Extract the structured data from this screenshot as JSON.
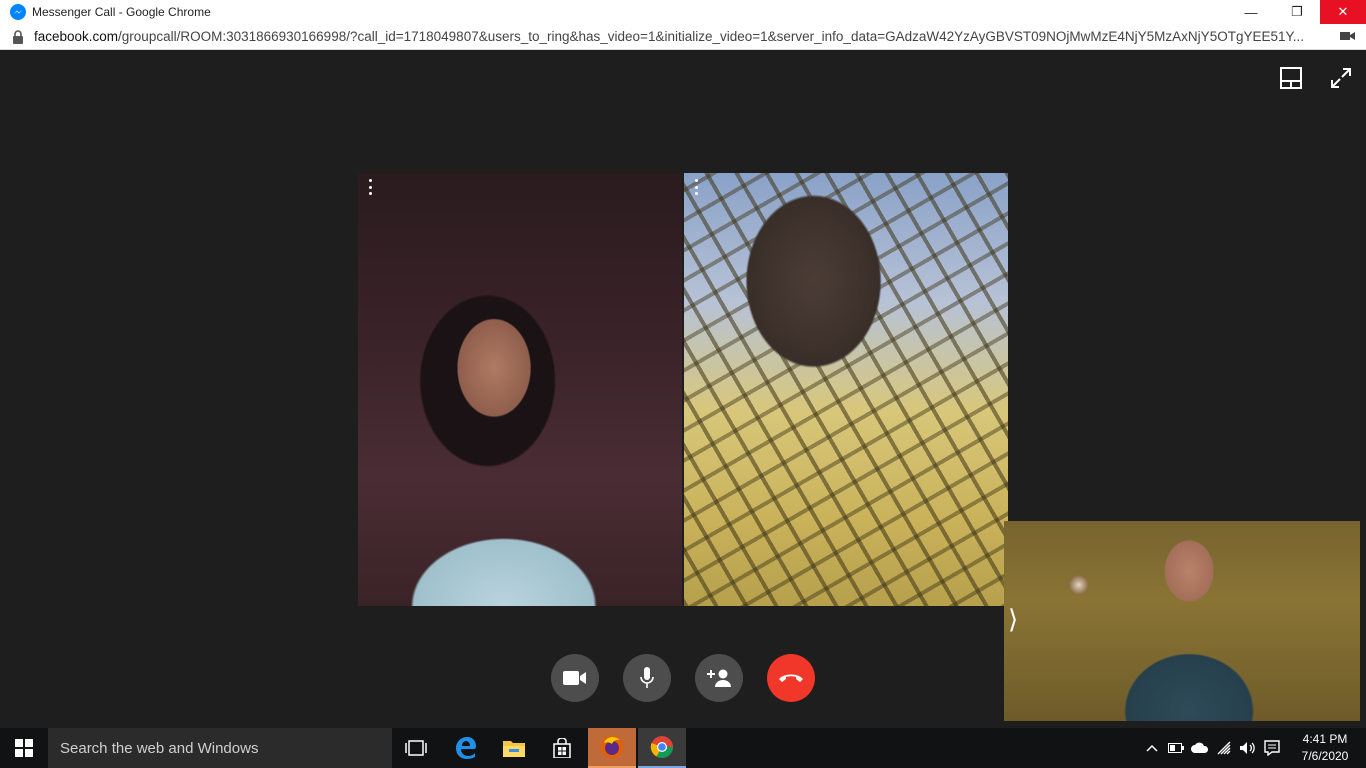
{
  "window": {
    "title": "Messenger Call - Google Chrome",
    "minimize": "—",
    "restore": "❐",
    "close": "✕"
  },
  "address": {
    "host": "facebook.com",
    "path": "/groupcall/ROOM:3031866930166998/?call_id=1718049807&users_to_ring&has_video=1&initialize_video=1&server_info_data=GAdzaW42YzAyGBVST09NOjMwMzE4NjY5MzAxNjY5OTgYEE51Y..."
  },
  "call": {
    "controls": [
      "video-toggle",
      "microphone-toggle",
      "add-participant",
      "end-call"
    ],
    "self_view_toggle": "⟩"
  },
  "taskbar": {
    "search_placeholder": "Search the web and Windows",
    "time": "4:41 PM",
    "date": "7/6/2020"
  },
  "colors": {
    "call_background": "#1e1e1e",
    "end_call": "#f0372a",
    "control_button": "#4d4d4d",
    "close_button": "#e81123"
  }
}
